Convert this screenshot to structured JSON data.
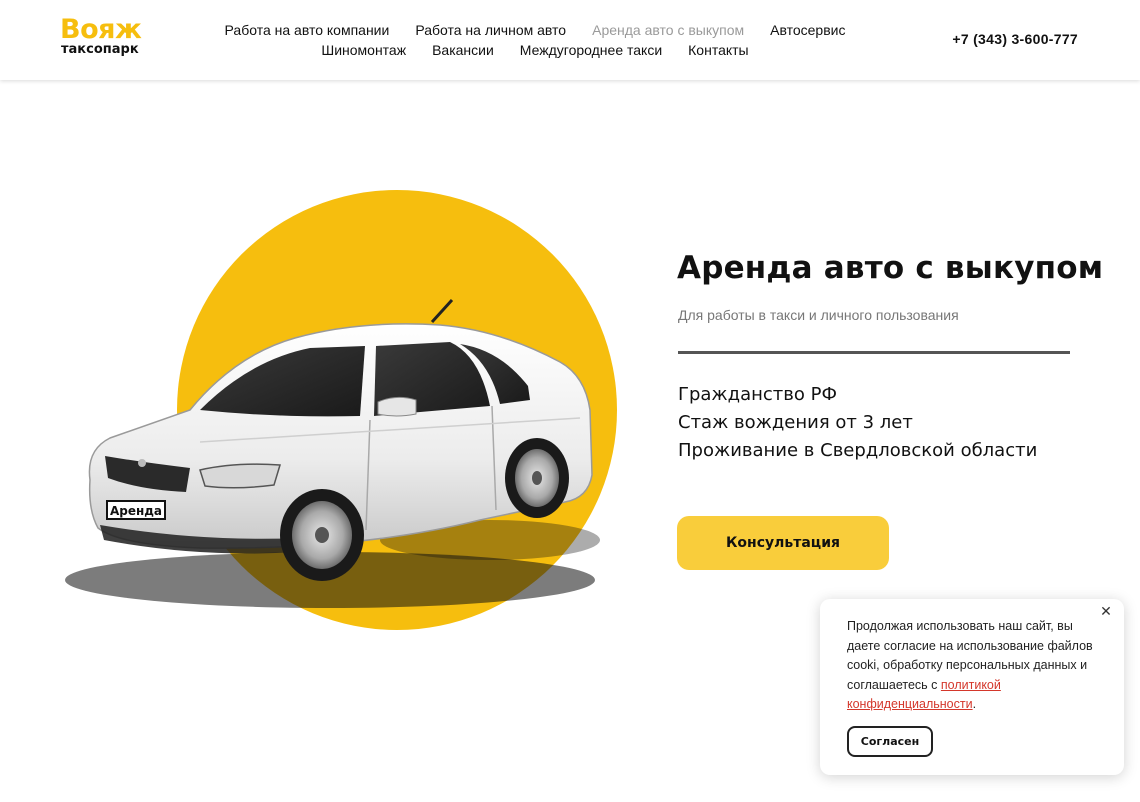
{
  "header": {
    "logo_main": "Вояж",
    "logo_sub": "таксопарк",
    "nav_row1": [
      {
        "label": "Работа на авто компании",
        "active": false
      },
      {
        "label": "Работа на личном авто",
        "active": false
      },
      {
        "label": "Аренда авто с выкупом",
        "active": true
      },
      {
        "label": "Автосервис",
        "active": false
      }
    ],
    "nav_row2": [
      {
        "label": "Шиномонтаж",
        "active": false
      },
      {
        "label": "Вакансии",
        "active": false
      },
      {
        "label": "Междугороднее такси",
        "active": false
      },
      {
        "label": "Контакты",
        "active": false
      }
    ],
    "phone": "+7 (343) 3-600-777"
  },
  "hero": {
    "plate_text": "Аренда",
    "title": "Аренда авто с выкупом",
    "subtitle": "Для работы в такси и личного пользования",
    "requirements": [
      "Гражданство РФ",
      "Стаж вождения от 3 лет",
      "Проживание в Свердловской области"
    ],
    "button_label": "Консультация"
  },
  "cookie": {
    "text_before": "Продолжая использовать наш сайт, вы даете согласие на использование файлов cooki, обработку персональных данных и соглашаетесь с ",
    "link_text": "политикой конфиденциальности",
    "text_after": ".",
    "close_symbol": "✕",
    "accept_label": "Согласен"
  },
  "colors": {
    "accent_yellow": "#f6be0e",
    "button_yellow": "#f9cd3b",
    "link_red": "#d4372b",
    "active_nav_gray": "#9a9a9a"
  },
  "icons": {
    "close": "close-icon"
  }
}
